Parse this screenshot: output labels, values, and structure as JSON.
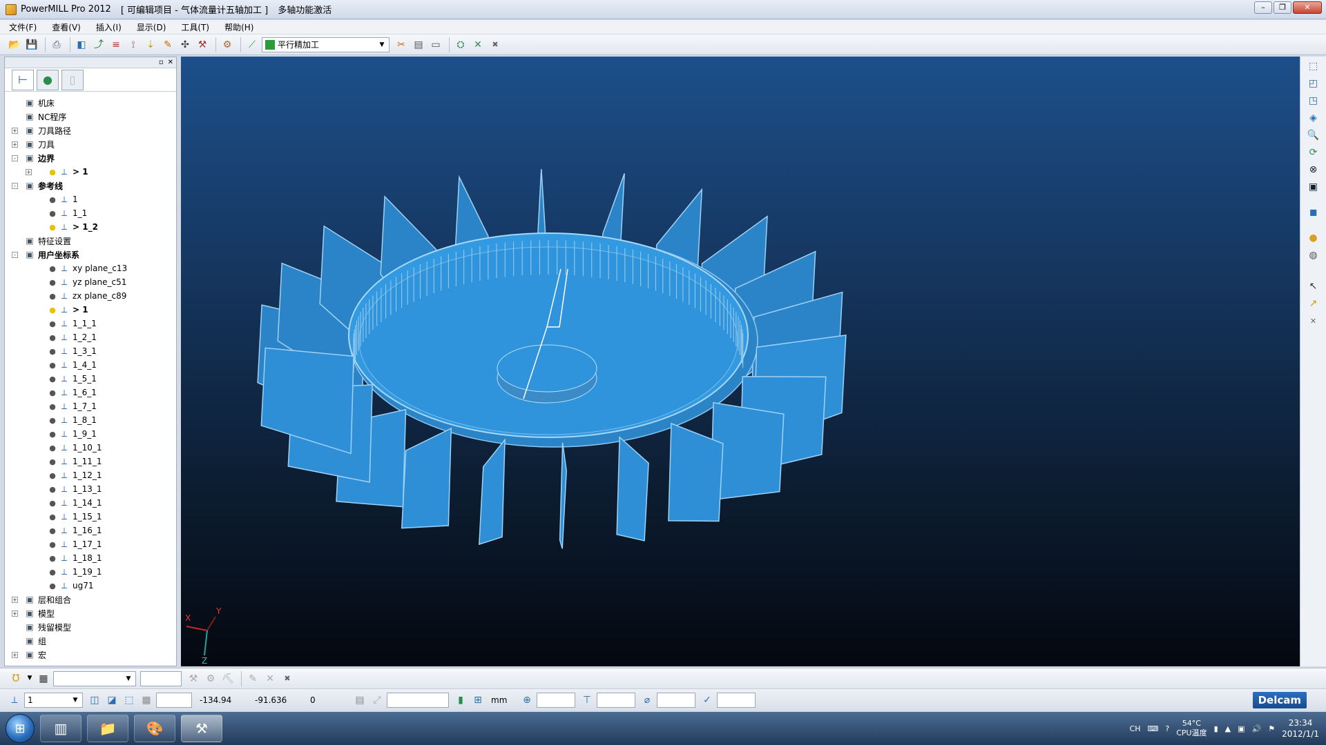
{
  "window": {
    "app_title": "PowerMILL Pro 2012",
    "project_title": "[ 可编辑项目 - 气体流量计五轴加工 ]",
    "license_status": "多轴功能激活"
  },
  "menu": [
    "文件(F)",
    "查看(V)",
    "插入(I)",
    "显示(D)",
    "工具(T)",
    "帮助(H)"
  ],
  "toolbar": {
    "strategy_combo": "平行精加工"
  },
  "explorer": {
    "items": [
      {
        "label": "机床",
        "level": 0,
        "expander": "",
        "bold": false
      },
      {
        "label": "NC程序",
        "level": 0,
        "expander": "",
        "bold": false
      },
      {
        "label": "刀具路径",
        "level": 0,
        "expander": "+",
        "bold": false
      },
      {
        "label": "刀具",
        "level": 0,
        "expander": "+",
        "bold": false
      },
      {
        "label": "边界",
        "level": 0,
        "expander": "-",
        "bold": true
      },
      {
        "label": "> 1",
        "level": 1,
        "expander": "+",
        "bold": true
      },
      {
        "label": "参考线",
        "level": 0,
        "expander": "-",
        "bold": true
      },
      {
        "label": "1",
        "level": 1,
        "expander": "",
        "bold": false
      },
      {
        "label": "1_1",
        "level": 1,
        "expander": "",
        "bold": false
      },
      {
        "label": "> 1_2",
        "level": 1,
        "expander": "",
        "bold": true
      },
      {
        "label": "特征设置",
        "level": 0,
        "expander": "",
        "bold": false
      },
      {
        "label": "用户坐标系",
        "level": 0,
        "expander": "-",
        "bold": true
      },
      {
        "label": "xy plane_c13",
        "level": 1,
        "expander": "",
        "bold": false
      },
      {
        "label": "yz plane_c51",
        "level": 1,
        "expander": "",
        "bold": false
      },
      {
        "label": "zx plane_c89",
        "level": 1,
        "expander": "",
        "bold": false
      },
      {
        "label": "> 1",
        "level": 1,
        "expander": "",
        "bold": true
      },
      {
        "label": "1_1_1",
        "level": 1,
        "expander": "",
        "bold": false
      },
      {
        "label": "1_2_1",
        "level": 1,
        "expander": "",
        "bold": false
      },
      {
        "label": "1_3_1",
        "level": 1,
        "expander": "",
        "bold": false
      },
      {
        "label": "1_4_1",
        "level": 1,
        "expander": "",
        "bold": false
      },
      {
        "label": "1_5_1",
        "level": 1,
        "expander": "",
        "bold": false
      },
      {
        "label": "1_6_1",
        "level": 1,
        "expander": "",
        "bold": false
      },
      {
        "label": "1_7_1",
        "level": 1,
        "expander": "",
        "bold": false
      },
      {
        "label": "1_8_1",
        "level": 1,
        "expander": "",
        "bold": false
      },
      {
        "label": "1_9_1",
        "level": 1,
        "expander": "",
        "bold": false
      },
      {
        "label": "1_10_1",
        "level": 1,
        "expander": "",
        "bold": false
      },
      {
        "label": "1_11_1",
        "level": 1,
        "expander": "",
        "bold": false
      },
      {
        "label": "1_12_1",
        "level": 1,
        "expander": "",
        "bold": false
      },
      {
        "label": "1_13_1",
        "level": 1,
        "expander": "",
        "bold": false
      },
      {
        "label": "1_14_1",
        "level": 1,
        "expander": "",
        "bold": false
      },
      {
        "label": "1_15_1",
        "level": 1,
        "expander": "",
        "bold": false
      },
      {
        "label": "1_16_1",
        "level": 1,
        "expander": "",
        "bold": false
      },
      {
        "label": "1_17_1",
        "level": 1,
        "expander": "",
        "bold": false
      },
      {
        "label": "1_18_1",
        "level": 1,
        "expander": "",
        "bold": false
      },
      {
        "label": "1_19_1",
        "level": 1,
        "expander": "",
        "bold": false
      },
      {
        "label": "ug71",
        "level": 1,
        "expander": "",
        "bold": false
      },
      {
        "label": "层和组合",
        "level": 0,
        "expander": "+",
        "bold": false
      },
      {
        "label": "模型",
        "level": 0,
        "expander": "+",
        "bold": false
      },
      {
        "label": "残留模型",
        "level": 0,
        "expander": "",
        "bold": false
      },
      {
        "label": "组",
        "level": 0,
        "expander": "",
        "bold": false
      },
      {
        "label": "宏",
        "level": 0,
        "expander": "+",
        "bold": false
      }
    ]
  },
  "viewport": {
    "axis_x": "X",
    "axis_y": "Y",
    "axis_z": "Z"
  },
  "statusbar": {
    "workplane_value": "1",
    "coord_x": "-134.94",
    "coord_y": "-91.636",
    "coord_z": "0",
    "units": "mm",
    "brand": "Delcam"
  },
  "taskbar": {
    "lang": "CH",
    "temp_value": "54°C",
    "temp_label": "CPU温度",
    "time": "23:34",
    "date": "2012/1/1"
  },
  "colors": {
    "model_blue": "#2f94dc",
    "viewport_top": "#1d4f8a",
    "viewport_bottom": "#040810"
  }
}
